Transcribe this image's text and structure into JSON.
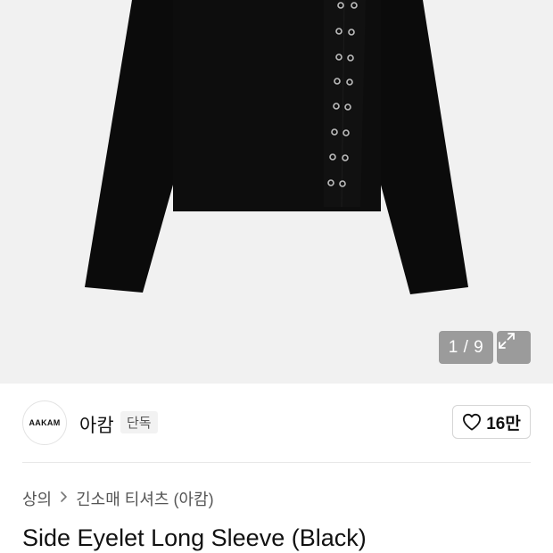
{
  "gallery": {
    "counter": "1 / 9",
    "icons": {
      "expand": "expand-arrows-icon"
    }
  },
  "brand": {
    "logo_text": "AAKAM",
    "name": "아캄",
    "badge": "단독"
  },
  "like": {
    "icon": "heart-icon",
    "count": "16만"
  },
  "breadcrumb": {
    "items": [
      "상의",
      "긴소매 티셔츠 (아캄)"
    ],
    "separator_icon": "chevron-right-icon"
  },
  "product": {
    "title": "Side Eyelet Long Sleeve (Black)"
  },
  "colors": {
    "image_bg": "#f1f1f1",
    "garment": "#0b0b0b",
    "overlay": "#8c8c8c"
  }
}
